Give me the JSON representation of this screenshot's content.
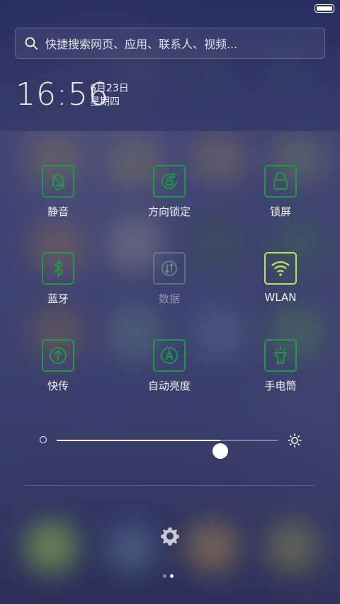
{
  "search": {
    "placeholder": "快捷搜索网页、应用、联系人、视频..."
  },
  "clock": {
    "time": "16:56",
    "date": "6月23日",
    "weekday": "星期四"
  },
  "toggles": [
    {
      "label": "静音",
      "icon": "mute-bell-icon",
      "state": "off"
    },
    {
      "label": "方向锁定",
      "icon": "rotation-lock-icon",
      "state": "off"
    },
    {
      "label": "锁屏",
      "icon": "lock-icon",
      "state": "off"
    },
    {
      "label": "蓝牙",
      "icon": "bluetooth-icon",
      "state": "off"
    },
    {
      "label": "数据",
      "icon": "mobile-data-icon",
      "state": "disabled"
    },
    {
      "label": "WLAN",
      "icon": "wifi-icon",
      "state": "on"
    },
    {
      "label": "快传",
      "icon": "quick-transfer-icon",
      "state": "off"
    },
    {
      "label": "自动亮度",
      "icon": "auto-brightness-icon",
      "state": "off"
    },
    {
      "label": "手电筒",
      "icon": "flashlight-icon",
      "state": "off"
    }
  ],
  "brightness": {
    "level": 0.74
  },
  "pager": {
    "pages": 2,
    "current": 2
  },
  "colors": {
    "toggle_border": "#1f9a41",
    "toggle_active": "#b4e84a"
  }
}
